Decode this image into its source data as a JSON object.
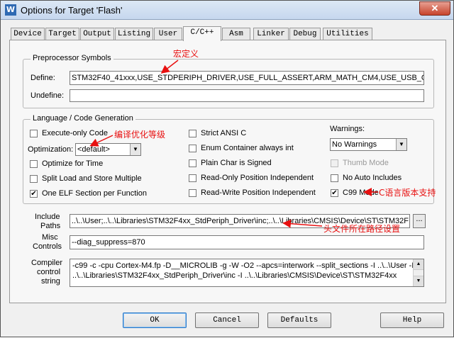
{
  "window": {
    "title": "Options for Target 'Flash'",
    "close_label": "✕"
  },
  "tabs": [
    {
      "label": "Device"
    },
    {
      "label": "Target"
    },
    {
      "label": "Output"
    },
    {
      "label": "Listing"
    },
    {
      "label": "User"
    },
    {
      "label": "C/C++"
    },
    {
      "label": "Asm"
    },
    {
      "label": "Linker"
    },
    {
      "label": "Debug"
    },
    {
      "label": "Utilities"
    }
  ],
  "active_tab": "C/C++",
  "preprocessor": {
    "title": "Preprocessor Symbols",
    "define_label": "Define:",
    "define_value": "STM32F40_41xxx,USE_STDPERIPH_DRIVER,USE_FULL_ASSERT,ARM_MATH_CM4,USE_USB_OT",
    "undefine_label": "Undefine:",
    "undefine_value": ""
  },
  "language": {
    "title": "Language / Code Generation",
    "execute_only": "Execute-only Code",
    "optimization_label": "Optimization:",
    "optimization_value": "<default>",
    "optimize_time": "Optimize for Time",
    "split_load": "Split Load and Store Multiple",
    "one_elf": "One ELF Section per Function",
    "strict_ansi": "Strict ANSI C",
    "enum_container": "Enum Container always int",
    "plain_char": "Plain Char is Signed",
    "ro_pi": "Read-Only Position Independent",
    "rw_pi": "Read-Write Position Independent",
    "warnings_label": "Warnings:",
    "warnings_value": "No Warnings",
    "thumb_mode": "Thumb Mode",
    "no_auto_includes": "No Auto Includes",
    "c99_mode": "C99 Mode"
  },
  "include_paths": {
    "label_line1": "Include",
    "label_line2": "Paths",
    "value": "..\\..\\User;..\\..\\Libraries\\STM32F4xx_StdPeriph_Driver\\inc;..\\..\\Libraries\\CMSIS\\Device\\ST\\STM32F",
    "browse_label": "..."
  },
  "misc": {
    "label_line1": "Misc",
    "label_line2": "Controls",
    "value": "--diag_suppress=870"
  },
  "compiler": {
    "label_line1": "Compiler",
    "label_line2": "control",
    "label_line3": "string",
    "line1": "-c99 -c -cpu Cortex-M4.fp -D__MICROLIB -g -W -O2 --apcs=interwork --split_sections -I ..\\..\\User -I",
    "line2": "..\\..\\Libraries\\STM32F4xx_StdPeriph_Driver\\inc -I ..\\..\\Libraries\\CMSIS\\Device\\ST\\STM32F4xx"
  },
  "buttons": {
    "ok": "OK",
    "cancel": "Cancel",
    "defaults": "Defaults",
    "help": "Help"
  },
  "annotations": {
    "macro": "宏定义",
    "optimize": "编译优化等级",
    "c_support": "C语言版本支持",
    "include": "头文件所在路径设置"
  },
  "colors": {
    "annotation": "#e81010",
    "titlebar": "#c6d7ee",
    "close": "#c7432b"
  }
}
